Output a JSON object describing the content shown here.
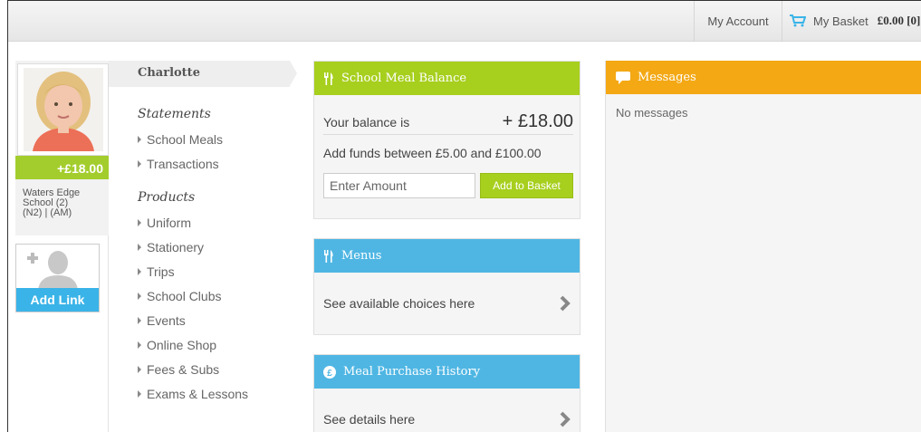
{
  "header": {
    "my_account": "My Account",
    "my_basket": "My Basket",
    "basket_amount": "£0.00 [0]"
  },
  "child": {
    "name": "Charlotte",
    "balance": "+£18.00",
    "school_line1": "Waters Edge",
    "school_line2": "School (2)",
    "school_line3": "(N2) | (AM)"
  },
  "add_link": {
    "label": "Add Link"
  },
  "menu": {
    "statements_heading": "Statements",
    "statements": [
      "School Meals",
      "Transactions"
    ],
    "products_heading": "Products",
    "products": [
      "Uniform",
      "Stationery",
      "Trips",
      "School Clubs",
      "Events",
      "Online Shop",
      "Fees & Subs",
      "Exams & Lessons"
    ]
  },
  "meal_balance": {
    "title": "School Meal Balance",
    "balance_label": "Your balance is",
    "balance_value": "+ £18.00",
    "funds_text": "Add funds between £5.00 and £100.00",
    "amount_placeholder": "Enter Amount",
    "add_button": "Add to Basket"
  },
  "menus_card": {
    "title": "Menus",
    "link_text": "See available choices here"
  },
  "history_card": {
    "title": "Meal Purchase History",
    "link_text": "See details here"
  },
  "messages": {
    "title": "Messages",
    "empty_text": "No messages"
  },
  "colors": {
    "green": "#a7cf1e",
    "blue": "#4fb6e3",
    "orange": "#f3a814",
    "link_blue": "#3ab4e8"
  }
}
